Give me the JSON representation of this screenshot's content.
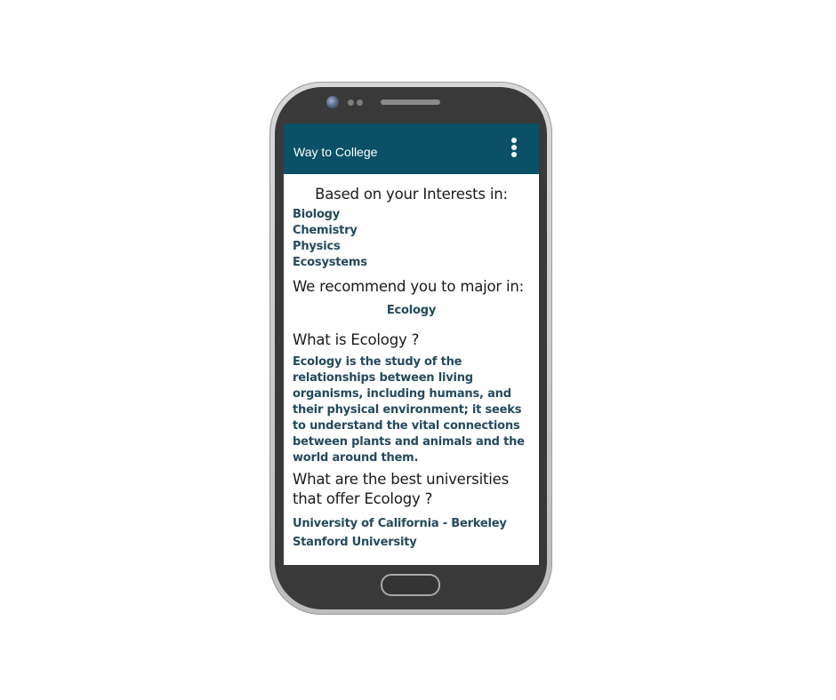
{
  "app": {
    "title": "Way to College",
    "menu_icon": "more-vert-icon"
  },
  "interests": {
    "heading": "Based on your Interests in:",
    "items": [
      "Biology",
      "Chemistry",
      "Physics",
      "Ecosystems"
    ]
  },
  "recommendation": {
    "heading": "We recommend you to major in:",
    "major": "Ecology"
  },
  "about": {
    "heading": "What is Ecology ?",
    "description": "Ecology is the study of the relationships between living organisms, including humans, and their physical environment; it seeks to understand the vital connections between plants and animals and the world around them."
  },
  "universities": {
    "heading": "What are the best universities that offer Ecology ?",
    "items": [
      "University of California - Berkeley",
      "Stanford University"
    ]
  },
  "colors": {
    "app_bar": "#0a5066",
    "accent_text": "#244a5c",
    "phone_body": "#393939",
    "phone_frame": "#c8c8c8"
  }
}
